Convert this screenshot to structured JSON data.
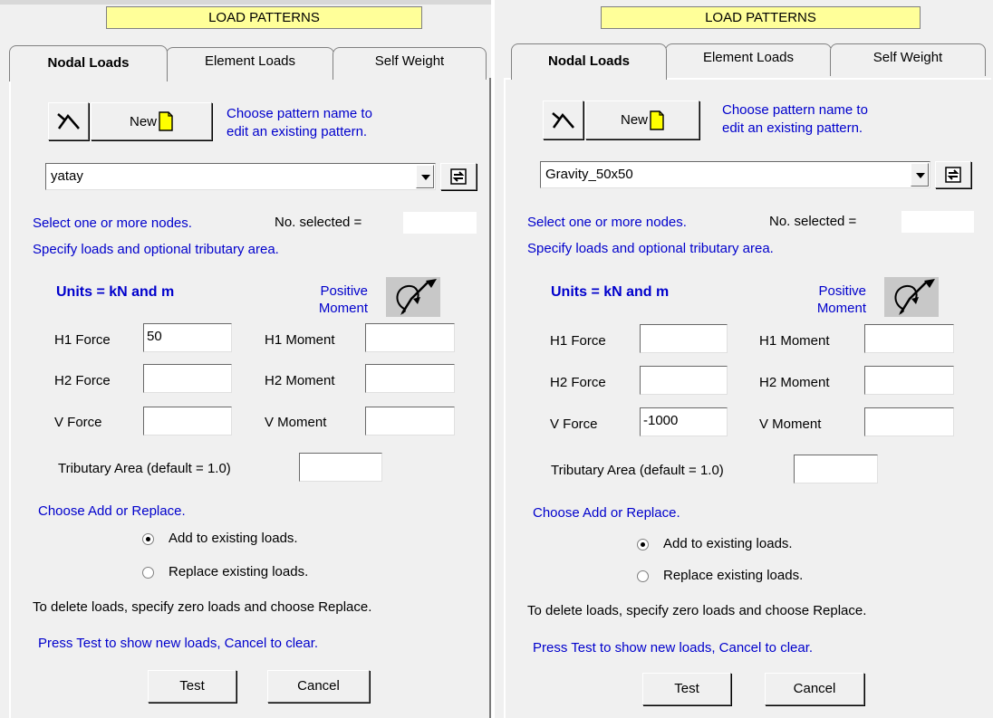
{
  "panels": [
    {
      "title": "LOAD PATTERNS",
      "tabs": [
        "Nodal Loads",
        "Element Loads",
        "Self Weight"
      ],
      "new_label": "New",
      "hint_line1": "Choose pattern name to",
      "hint_line2": "edit an existing pattern.",
      "pattern": "yatay",
      "select_nodes": "Select one or more nodes.",
      "no_selected_label": "No. selected =",
      "specify": "Specify loads and optional tributary area.",
      "units": "Units = kN and m",
      "positive": "Positive",
      "moment": "Moment",
      "h1_force_label": "H1 Force",
      "h1_force": "50",
      "h2_force_label": "H2 Force",
      "h2_force": "",
      "v_force_label": "V Force",
      "v_force": "",
      "h1_moment_label": "H1 Moment",
      "h1_moment": "",
      "h2_moment_label": "H2 Moment",
      "h2_moment": "",
      "v_moment_label": "V Moment",
      "v_moment": "",
      "trib_label": "Tributary Area (default = 1.0)",
      "trib": "",
      "choose": "Choose Add or Replace.",
      "add_label": "Add to existing loads.",
      "replace_label": "Replace existing loads.",
      "add_selected": true,
      "delete_note": "To delete loads, specify zero loads and choose Replace.",
      "press_note": "Press Test to show new loads, Cancel to clear.",
      "test_label": "Test",
      "cancel_label": "Cancel"
    },
    {
      "title": "LOAD PATTERNS",
      "tabs": [
        "Nodal Loads",
        "Element Loads",
        "Self Weight"
      ],
      "new_label": "New",
      "hint_line1": "Choose pattern name to",
      "hint_line2": "edit an existing pattern.",
      "pattern": "Gravity_50x50",
      "select_nodes": "Select one or more nodes.",
      "no_selected_label": "No. selected =",
      "specify": "Specify loads and optional tributary area.",
      "units": "Units = kN and m",
      "positive": "Positive",
      "moment": "Moment",
      "h1_force_label": "H1 Force",
      "h1_force": "",
      "h2_force_label": "H2 Force",
      "h2_force": "",
      "v_force_label": "V Force",
      "v_force": "-1000",
      "h1_moment_label": "H1 Moment",
      "h1_moment": "",
      "h2_moment_label": "H2 Moment",
      "h2_moment": "",
      "v_moment_label": "V Moment",
      "v_moment": "",
      "trib_label": "Tributary Area (default = 1.0)",
      "trib": "",
      "choose": "Choose Add or Replace.",
      "add_label": "Add to existing loads.",
      "replace_label": "Replace existing loads.",
      "add_selected": true,
      "delete_note": "To delete loads, specify zero loads and choose Replace.",
      "press_note": "Press Test to show new loads, Cancel to clear.",
      "test_label": "Test",
      "cancel_label": "Cancel"
    }
  ]
}
